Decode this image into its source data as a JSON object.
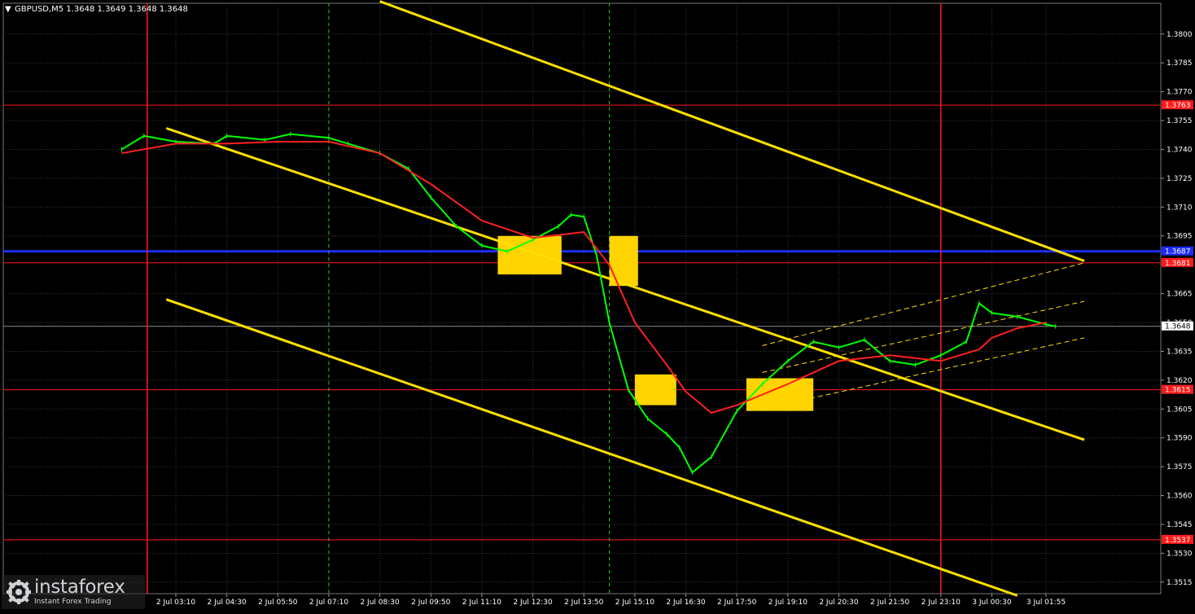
{
  "title": "GBPUSD,M5  1.3648 1.3649 1.3648 1.3648",
  "logo": {
    "name": "instaforex",
    "tagline": "Instant Forex Trading"
  },
  "colors": {
    "background": "#000000",
    "grid": "#3a3a3a",
    "candle": "#00ff00",
    "ma": "#ff2020",
    "channel": "#ffe000",
    "level_red": "#ff1a1a",
    "level_blue": "#1c2cff",
    "signal_box": "#ffd400",
    "text": "#ffffff"
  },
  "chart_data": {
    "type": "line",
    "symbol": "GBPUSD",
    "timeframe": "M5",
    "ylim": [
      1.3509,
      1.3816
    ],
    "x_ticks": [
      "2 Jul 03:10",
      "2 Jul 04:30",
      "2 Jul 05:50",
      "2 Jul 07:10",
      "2 Jul 08:30",
      "2 Jul 09:50",
      "2 Jul 11:10",
      "2 Jul 12:30",
      "2 Jul 13:50",
      "2 Jul 15:10",
      "2 Jul 16:30",
      "2 Jul 17:50",
      "2 Jul 19:10",
      "2 Jul 20:30",
      "2 Jul 21:50",
      "2 Jul 23:10",
      "3 Jul 00:30",
      "3 Jul 01:55"
    ],
    "y_ticks": [
      "1.3800",
      "1.3785",
      "1.3770",
      "1.3755",
      "1.3740",
      "1.3725",
      "1.3710",
      "1.3695",
      "1.3665",
      "1.3650",
      "1.3635",
      "1.3620",
      "1.3605",
      "1.3590",
      "1.3575",
      "1.3560",
      "1.3545",
      "1.3530",
      "1.3515"
    ],
    "series": [
      {
        "x": [
          "2 Jul 01:45",
          "2 Jul 02:20",
          "2 Jul 03:10",
          "2 Jul 04:10",
          "2 Jul 04:30",
          "2 Jul 05:30",
          "2 Jul 06:10",
          "2 Jul 07:10",
          "2 Jul 07:40",
          "2 Jul 08:30",
          "2 Jul 09:15",
          "2 Jul 09:50",
          "2 Jul 10:30",
          "2 Jul 11:10",
          "2 Jul 11:50",
          "2 Jul 12:30",
          "2 Jul 13:10",
          "2 Jul 13:30",
          "2 Jul 13:50",
          "2 Jul 14:10",
          "2 Jul 14:30",
          "2 Jul 15:00",
          "2 Jul 15:30",
          "2 Jul 16:00",
          "2 Jul 16:20",
          "2 Jul 16:40",
          "2 Jul 17:10",
          "2 Jul 17:50",
          "2 Jul 18:30",
          "2 Jul 19:10",
          "2 Jul 19:50",
          "2 Jul 20:30",
          "2 Jul 21:10",
          "2 Jul 21:50",
          "2 Jul 22:30",
          "2 Jul 23:10",
          "2 Jul 23:50",
          "3 Jul 00:10",
          "3 Jul 00:30",
          "3 Jul 01:10",
          "3 Jul 01:55",
          "3 Jul 02:10"
        ],
        "values": [
          1.374,
          1.3747,
          1.3744,
          1.3743,
          1.3747,
          1.3745,
          1.3748,
          1.3746,
          1.3743,
          1.3738,
          1.373,
          1.3715,
          1.37,
          1.369,
          1.3687,
          1.3693,
          1.37,
          1.3706,
          1.3705,
          1.3685,
          1.365,
          1.3615,
          1.36,
          1.3592,
          1.3585,
          1.3572,
          1.358,
          1.3604,
          1.3618,
          1.363,
          1.364,
          1.3637,
          1.3641,
          1.363,
          1.3628,
          1.3633,
          1.364,
          1.366,
          1.3655,
          1.3653,
          1.3649,
          1.3648
        ]
      },
      {
        "x": [
          "2 Jul 01:45",
          "2 Jul 03:10",
          "2 Jul 04:30",
          "2 Jul 05:50",
          "2 Jul 07:10",
          "2 Jul 08:30",
          "2 Jul 09:50",
          "2 Jul 11:10",
          "2 Jul 12:30",
          "2 Jul 13:50",
          "2 Jul 14:30",
          "2 Jul 15:10",
          "2 Jul 16:00",
          "2 Jul 16:30",
          "2 Jul 17:10",
          "2 Jul 17:50",
          "2 Jul 19:10",
          "2 Jul 20:30",
          "2 Jul 21:50",
          "2 Jul 23:10",
          "3 Jul 00:10",
          "3 Jul 00:30",
          "3 Jul 01:10",
          "3 Jul 01:55"
        ],
        "values": [
          1.3738,
          1.3743,
          1.3743,
          1.3744,
          1.3744,
          1.3738,
          1.3722,
          1.3703,
          1.3694,
          1.3697,
          1.368,
          1.365,
          1.3628,
          1.3614,
          1.3603,
          1.3607,
          1.3618,
          1.363,
          1.3633,
          1.363,
          1.3636,
          1.3642,
          1.3647,
          1.365
        ]
      }
    ],
    "horizontal_levels": [
      {
        "value": 1.3763,
        "label": "1.3763",
        "color": "#ff1a1a"
      },
      {
        "value": 1.3687,
        "label": "1.3687",
        "color": "#1c2cff"
      },
      {
        "value": 1.3681,
        "label": "1.3681",
        "color": "#ff1a1a"
      },
      {
        "value": 1.3615,
        "label": "1.3615",
        "color": "#ff1a1a"
      },
      {
        "value": 1.3537,
        "label": "1.3537",
        "color": "#ff1a1a"
      }
    ],
    "current_price": {
      "value": 1.3648,
      "label": "1.3648"
    },
    "vertical_markers": [
      {
        "x": "2 Jul 02:25",
        "style": "red-solid"
      },
      {
        "x": "2 Jul 07:10",
        "style": "green-dashed"
      },
      {
        "x": "2 Jul 14:30",
        "style": "green-dashed"
      },
      {
        "x": "2 Jul 23:10",
        "style": "red-solid"
      }
    ],
    "trend_lines": [
      {
        "points": [
          [
            "2 Jul 08:30",
            1.3817
          ],
          [
            "3 Jul 02:55",
            1.3682
          ]
        ],
        "style": "solid"
      },
      {
        "points": [
          [
            "2 Jul 02:55",
            1.3751
          ],
          [
            "3 Jul 02:55",
            1.3589
          ]
        ],
        "style": "solid"
      },
      {
        "points": [
          [
            "2 Jul 02:55",
            1.3662
          ],
          [
            "3 Jul 01:10",
            1.3508
          ]
        ],
        "style": "solid"
      },
      {
        "points": [
          [
            "2 Jul 18:30",
            1.3638
          ],
          [
            "3 Jul 02:55",
            1.3681
          ]
        ],
        "style": "dashed"
      },
      {
        "points": [
          [
            "2 Jul 18:30",
            1.3624
          ],
          [
            "3 Jul 02:55",
            1.3661
          ]
        ],
        "style": "dashed"
      },
      {
        "points": [
          [
            "2 Jul 18:30",
            1.3605
          ],
          [
            "3 Jul 02:55",
            1.3642
          ]
        ],
        "style": "dashed"
      }
    ],
    "signal_boxes": [
      {
        "from": "2 Jul 11:35",
        "to": "2 Jul 13:15",
        "low": 1.3675,
        "high": 1.3695
      },
      {
        "from": "2 Jul 14:30",
        "to": "2 Jul 15:15",
        "low": 1.3669,
        "high": 1.3695
      },
      {
        "from": "2 Jul 15:10",
        "to": "2 Jul 16:15",
        "low": 1.3607,
        "high": 1.3623
      },
      {
        "from": "2 Jul 18:05",
        "to": "2 Jul 19:50",
        "low": 1.3604,
        "high": 1.3621
      }
    ],
    "grid": true
  }
}
